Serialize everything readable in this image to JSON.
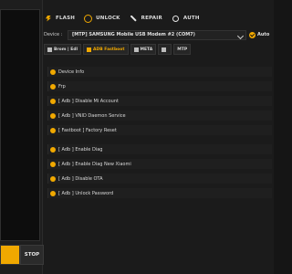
{
  "top_nav": {
    "items": [
      {
        "label": "FLASH",
        "icon": "flash-icon"
      },
      {
        "label": "UNLOCK",
        "icon": "unlock-icon"
      },
      {
        "label": "REPAIR",
        "icon": "repair-icon"
      },
      {
        "label": "AUTH",
        "icon": "auth-icon"
      }
    ]
  },
  "device": {
    "label": "Device :",
    "selected": "[MTP] SAMSUNG Mobile USB Modem #2 (COM7)",
    "auto_label": "Auto"
  },
  "tabs": [
    {
      "label": "Brom | Edl",
      "active": false
    },
    {
      "label": "ADB Fastboot",
      "active": true
    },
    {
      "label": "META",
      "active": false
    },
    {
      "label": "",
      "active": false
    },
    {
      "label": "MTP",
      "active": false
    }
  ],
  "actions": [
    "Device Info",
    "Frp",
    "[ Adb ] Disable Mi Account",
    "[ Adb ] VNID Daemon Service",
    "[ Fastboot ] Factory Reset",
    "[ Adb ] Enable Diag",
    "[ Adb ] Enable Diag  New Xiaomi",
    "[ Adb ] Disable OTA",
    "[ Adb ] Unlock Password"
  ],
  "bottom": {
    "stop_label": "STOP",
    "progress": 1.0
  },
  "colors": {
    "accent": "#f0a800",
    "background": "#1b1b1b"
  }
}
